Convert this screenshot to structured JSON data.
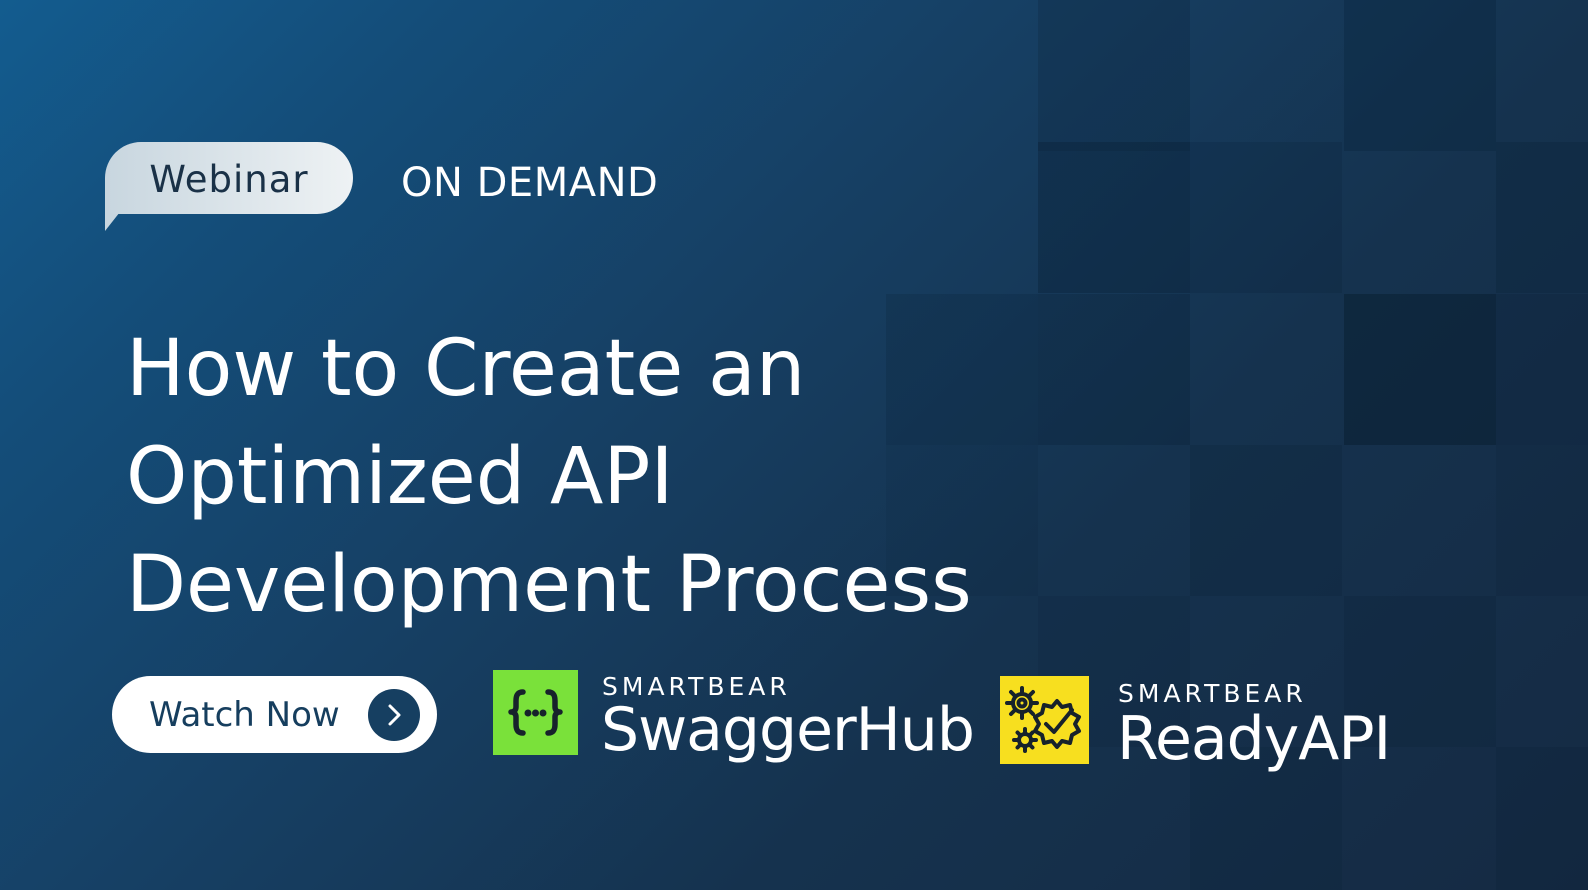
{
  "banner": {
    "badge": "Webinar",
    "tag": "ON DEMAND",
    "title_lines": [
      "How to Create an",
      "Optimized API",
      "Development Process"
    ]
  },
  "cta": {
    "label": "Watch Now",
    "icon": "chevron-right-icon"
  },
  "brands": [
    {
      "company": "SMARTBEAR",
      "product": "SwaggerHub",
      "icon": "swaggerhub-logo-icon",
      "color": "#7ae13a"
    },
    {
      "company": "SMARTBEAR",
      "product": "ReadyAPI",
      "icon": "readyapi-gears-logo-icon",
      "color": "#f7df1f"
    }
  ],
  "colors": {
    "background": "#15324e",
    "accent": "#163f61"
  }
}
